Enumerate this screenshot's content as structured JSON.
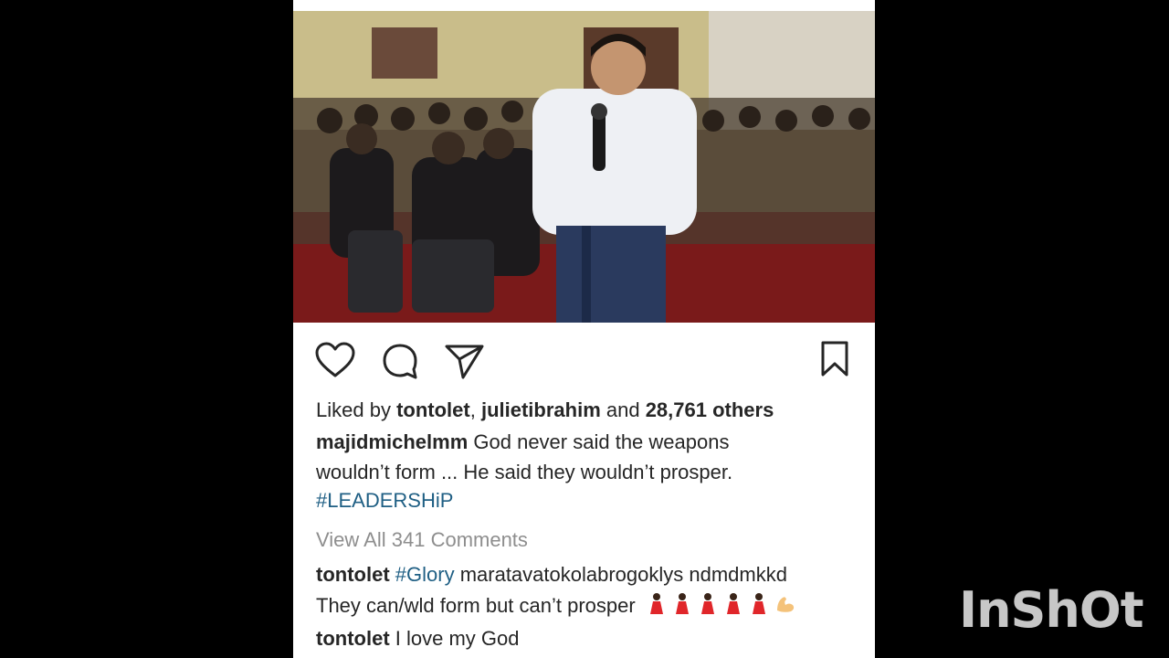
{
  "post": {
    "likes": {
      "prefix": "Liked by ",
      "user1": "tontolet",
      "sep": ", ",
      "user2": "julietibrahim",
      "and": " and ",
      "count": "28,761 others"
    },
    "caption": {
      "username": "majidmichelmm",
      "line1": " God never said the weapons",
      "line2": "wouldn’t form ... He said they wouldn’t prosper.",
      "hashtag": "#LEADERSHiP"
    },
    "view_comments": "View All 341 Comments",
    "comments": [
      {
        "username": "tontolet",
        "hashtag": "#Glory",
        "line1": " maratavatokolabrogoklys ndmdmkkd",
        "line2": "They can/wld form but can’t prosper"
      },
      {
        "username": "tontolet",
        "text": " I love my God"
      }
    ]
  },
  "icons": {
    "like": "heart-icon",
    "comment": "comment-bubble-icon",
    "share": "paper-plane-icon",
    "save": "bookmark-icon",
    "emoji_reactions": [
      "woman-dancing-emoji",
      "woman-dancing-emoji",
      "woman-dancing-emoji",
      "woman-dancing-emoji",
      "woman-dancing-emoji",
      "flexed-biceps-emoji"
    ]
  },
  "colors": {
    "hashtag": "#1f5f84",
    "text": "#262626",
    "muted": "#8e8e8e"
  },
  "watermark": "InShOt"
}
